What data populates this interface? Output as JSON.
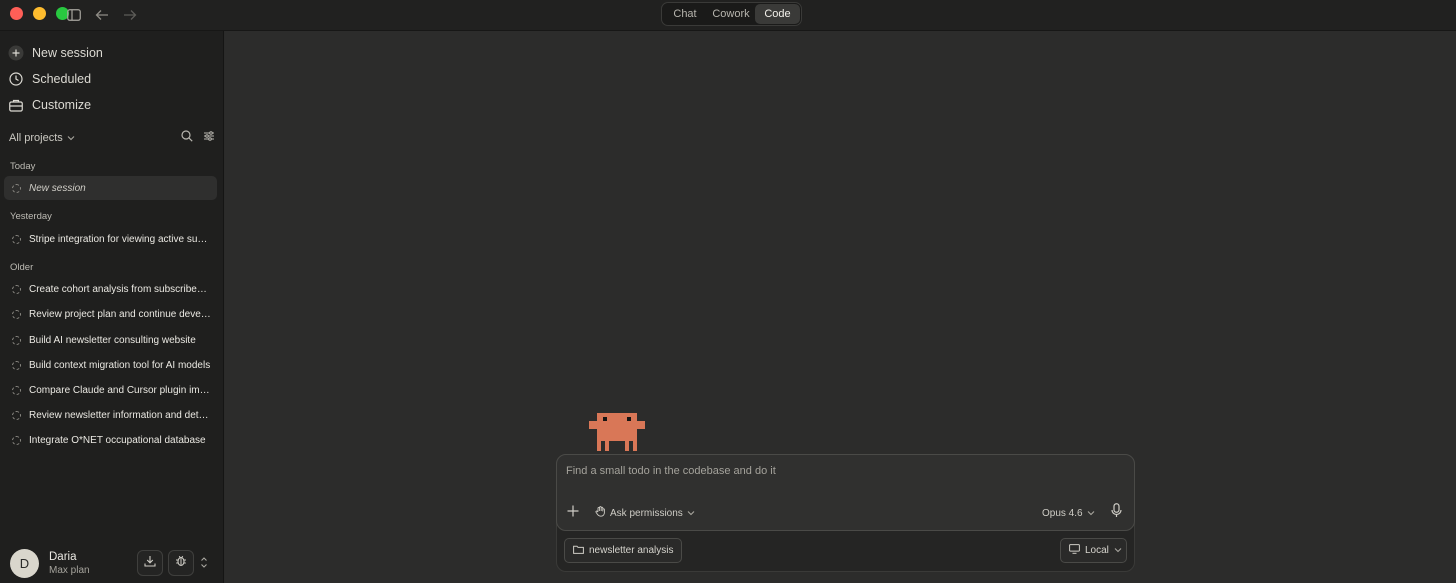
{
  "titlebar": {
    "tabs": [
      {
        "label": "Chat",
        "active": false
      },
      {
        "label": "Cowork",
        "active": false
      },
      {
        "label": "Code",
        "active": true
      }
    ]
  },
  "sidebar": {
    "nav": [
      {
        "label": "New session",
        "icon": "plus-circle-icon"
      },
      {
        "label": "Scheduled",
        "icon": "clock-icon"
      },
      {
        "label": "Customize",
        "icon": "briefcase-icon"
      }
    ],
    "projects_label": "All projects",
    "sections": {
      "today": "Today",
      "yesterday": "Yesterday",
      "older": "Older"
    },
    "sessions_today": [
      "New session"
    ],
    "sessions_yesterday": [
      "Stripe integration for viewing active su…"
    ],
    "sessions_older": [
      "Create cohort analysis from subscribe…",
      "Review project plan and continue deve…",
      "Build AI newsletter consulting website",
      "Build context migration tool for AI models",
      "Compare Claude and Cursor plugin im…",
      "Review newsletter information and det…",
      "Integrate O*NET occupational database"
    ],
    "user": {
      "initial": "D",
      "name": "Daria",
      "plan": "Max plan"
    }
  },
  "composer": {
    "placeholder": "Find a small todo in the codebase and do it",
    "permissions_label": "Ask permissions",
    "model_label": "Opus 4.6",
    "folder_chip": "newsletter analysis",
    "env_chip": "Local"
  },
  "colors": {
    "accent_mascot": "#d97757",
    "traffic_red": "#ff5f57",
    "traffic_yellow": "#febc2e",
    "traffic_green": "#28c840"
  }
}
